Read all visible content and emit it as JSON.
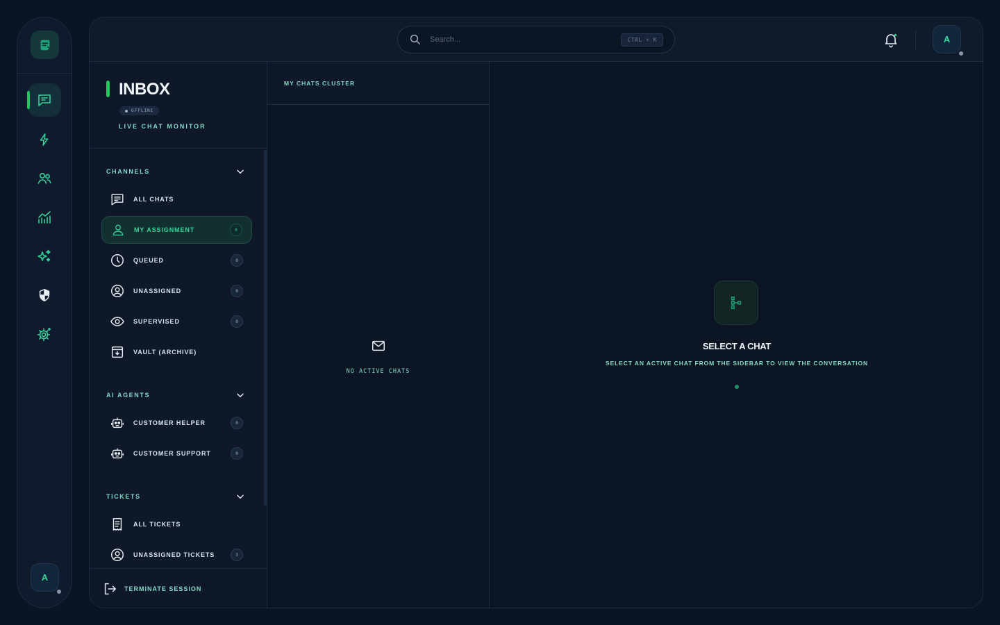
{
  "rail": {
    "avatar_initial": "A",
    "nav": [
      {
        "icon": "chat-icon",
        "active": true
      },
      {
        "icon": "lightning-icon",
        "active": false
      },
      {
        "icon": "users-icon",
        "active": false
      },
      {
        "icon": "analytics-icon",
        "active": false
      },
      {
        "icon": "sparkles-icon",
        "active": false
      },
      {
        "icon": "shield-icon",
        "active": false
      },
      {
        "icon": "settings-icon",
        "active": false
      }
    ]
  },
  "topbar": {
    "search_placeholder": "Search...",
    "shortcut": "CTRL + K",
    "avatar_initial": "A"
  },
  "sidebar": {
    "title": "INBOX",
    "status": "OFFLINE",
    "subtitle": "LIVE CHAT MONITOR",
    "channels": {
      "label": "CHANNELS",
      "items": [
        {
          "label": "ALL CHATS",
          "icon": "chat-lines-icon"
        },
        {
          "label": "MY ASSIGNMENT",
          "icon": "user-icon",
          "count": "0",
          "active": true
        },
        {
          "label": "QUEUED",
          "icon": "clock-icon",
          "count": "0"
        },
        {
          "label": "UNASSIGNED",
          "icon": "user-circle-icon",
          "count": "0"
        },
        {
          "label": "SUPERVISED",
          "icon": "eye-icon",
          "count": "0"
        },
        {
          "label": "VAULT (ARCHIVE)",
          "icon": "archive-icon"
        }
      ]
    },
    "ai_agents": {
      "label": "AI AGENTS",
      "items": [
        {
          "label": "CUSTOMER HELPER",
          "icon": "robot-icon",
          "count": "0"
        },
        {
          "label": "CUSTOMER SUPPORT",
          "icon": "robot-icon",
          "count": "0"
        }
      ]
    },
    "tickets": {
      "label": "TICKETS",
      "items": [
        {
          "label": "ALL TICKETS",
          "icon": "receipt-icon"
        },
        {
          "label": "UNASSIGNED TICKETS",
          "icon": "user-circle-icon",
          "count": "3"
        }
      ]
    },
    "footer_label": "TERMINATE SESSION"
  },
  "chat_list": {
    "header": "MY CHATS CLUSTER",
    "empty_text": "NO ACTIVE CHATS"
  },
  "conversation": {
    "title": "SELECT A CHAT",
    "subtitle": "SELECT AN ACTIVE CHAT FROM THE SIDEBAR TO VIEW THE CONVERSATION"
  },
  "colors": {
    "accent": "#22c55e",
    "accent_text": "#34d399",
    "muted_accent": "#86d8c4",
    "background": "#0b1422"
  }
}
